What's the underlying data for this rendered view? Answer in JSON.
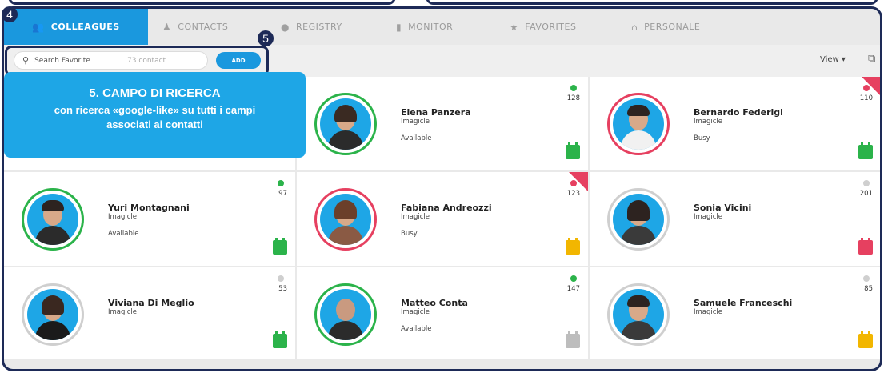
{
  "tabs": [
    {
      "label": "COLLEAGUES",
      "icon": "people-icon",
      "glyph": "👥",
      "active": true
    },
    {
      "label": "CONTACTS",
      "icon": "contact-icon",
      "glyph": "♟",
      "active": false
    },
    {
      "label": "REGISTRY",
      "icon": "registry-icon",
      "glyph": "●",
      "active": false
    },
    {
      "label": "MONITOR",
      "icon": "monitor-icon",
      "glyph": "▮",
      "active": false
    },
    {
      "label": "FAVORITES",
      "icon": "star-icon",
      "glyph": "★",
      "active": false
    },
    {
      "label": "PERSONALE",
      "icon": "home-icon",
      "glyph": "⌂",
      "active": false
    }
  ],
  "toolbar": {
    "search_placeholder": "Search Favorite",
    "contact_count": "73 contact",
    "add_label": "ADD",
    "view_label": "View ▾"
  },
  "badges": {
    "b4": "4",
    "b5": "5"
  },
  "callout": {
    "title": "5. CAMPO DI RICERCA",
    "line1": "con ricerca «google-like» su tutti i campi",
    "line2": "associati ai contatti"
  },
  "contacts": [
    {
      "name": "Elena Panzera",
      "org": "Imagicle",
      "status": "Available",
      "number": "128",
      "presence": "green",
      "ring": "green",
      "calendar": "#2bb34a",
      "corner": false
    },
    {
      "name": "Bernardo Federigi",
      "org": "Imagicle",
      "status": "Busy",
      "number": "110",
      "presence": "red",
      "ring": "busy",
      "calendar": "#2bb34a",
      "corner": true
    },
    {
      "name": "Yuri Montagnani",
      "org": "Imagicle",
      "status": "Available",
      "number": "97",
      "presence": "green",
      "ring": "green",
      "calendar": "#2bb34a",
      "corner": false
    },
    {
      "name": "Fabiana Andreozzi",
      "org": "Imagicle",
      "status": "Busy",
      "number": "123",
      "presence": "red",
      "ring": "busy",
      "calendar": "#f2b600",
      "corner": true
    },
    {
      "name": "Sonia Vicini",
      "org": "Imagicle",
      "status": "",
      "number": "201",
      "presence": "grey",
      "ring": "none",
      "calendar": "#e64060",
      "corner": false
    },
    {
      "name": "Viviana Di Meglio",
      "org": "Imagicle",
      "status": "",
      "number": "53",
      "presence": "grey",
      "ring": "none",
      "calendar": "#2bb34a",
      "corner": false
    },
    {
      "name": "Matteo Conta",
      "org": "Imagicle",
      "status": "Available",
      "number": "147",
      "presence": "green",
      "ring": "green",
      "calendar": "#bdbdbd",
      "corner": false
    },
    {
      "name": "Samuele Franceschi",
      "org": "Imagicle",
      "status": "",
      "number": "85",
      "presence": "grey",
      "ring": "none",
      "calendar": "#f2b600",
      "corner": false
    }
  ],
  "colors": {
    "accent": "#1a98de",
    "frame": "#1d2a57",
    "available": "#2bb34a",
    "busy": "#e64060",
    "offline": "#cfcfcf"
  }
}
